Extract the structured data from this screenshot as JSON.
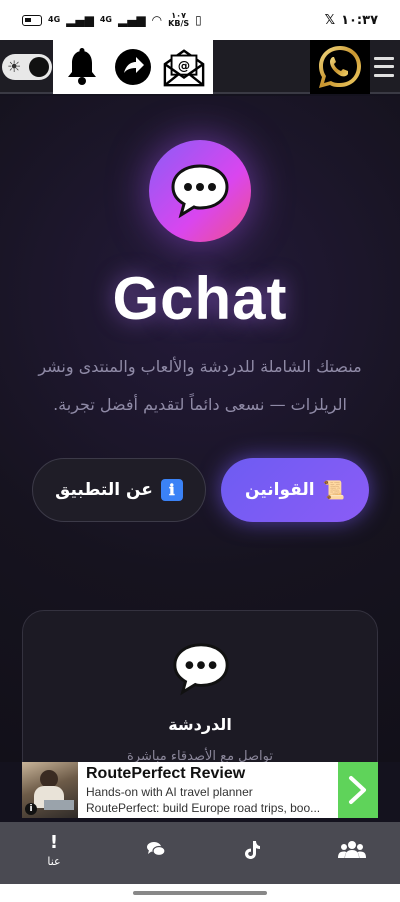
{
  "status_bar": {
    "time": "١٠:٣٧",
    "network_label": "4G",
    "network_label_2": "4G",
    "speed_value": "١٠٧",
    "speed_unit": "KB/S",
    "x_logo": "𝕏"
  },
  "toolbar": {
    "theme_toggle_icon": "sun-icon",
    "icons": [
      "bell-icon",
      "share-icon",
      "email-icon"
    ],
    "whatsapp_icon": "whatsapp-icon",
    "menu_icon": "hamburger-menu-icon"
  },
  "hero": {
    "brand": "Gchat",
    "tagline": "منصتك الشاملة للدردشة والألعاب والمنتدى ونشر الريلزات — نسعى دائماً لتقديم أفضل تجربة.",
    "rules_button": "القوانين",
    "about_button": "عن التطبيق",
    "rules_emoji": "📜",
    "about_emoji": "ℹ"
  },
  "feature_card": {
    "icon": "speech-bubble-icon",
    "title": "الدردشة",
    "description": "تواصل مع الأصدقاء مباشرة"
  },
  "ad": {
    "title": "RoutePerfect Review",
    "line1": "Hands-on with AI travel planner",
    "line2": "RoutePerfect: build Europe road trips, boo...",
    "info": "i"
  },
  "bottom_nav": {
    "about_label": "عنا",
    "about_icon_text": "!",
    "items": [
      "about-icon",
      "chat-icon",
      "tiktok-icon",
      "group-icon"
    ]
  },
  "colors": {
    "accent_gradient_start": "#8b5cf6",
    "accent_gradient_end": "#f0508a",
    "rules_button": "#6d5cf2",
    "background": "#14121e",
    "ad_cta": "#5fd35a"
  }
}
